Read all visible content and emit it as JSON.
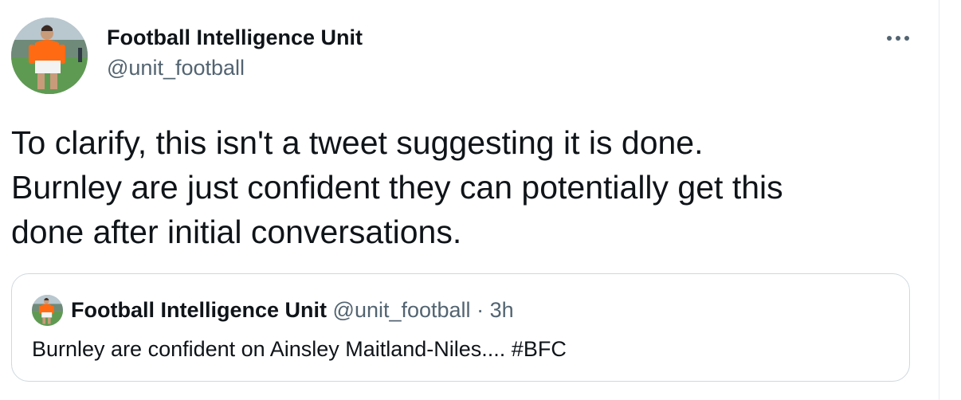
{
  "tweet": {
    "author": {
      "display_name": "Football Intelligence Unit",
      "handle": "@unit_football",
      "avatar_icon": "avatar-icon"
    },
    "more_icon": "more-options-icon",
    "text_lines": [
      "To clarify, this isn't a tweet suggesting it is done.",
      "Burnley are just confident they can potentially get this",
      "done after initial conversations."
    ]
  },
  "quoted_tweet": {
    "display_name": "Football Intelligence Unit",
    "handle": "@unit_football",
    "separator": "·",
    "timestamp": "3h",
    "text": "Burnley are confident on Ainsley Maitland-Niles.... #BFC"
  },
  "colors": {
    "text_primary": "#0f1419",
    "text_secondary": "#536471",
    "border": "#cfd9de",
    "jersey_orange": "#ff6a13"
  }
}
